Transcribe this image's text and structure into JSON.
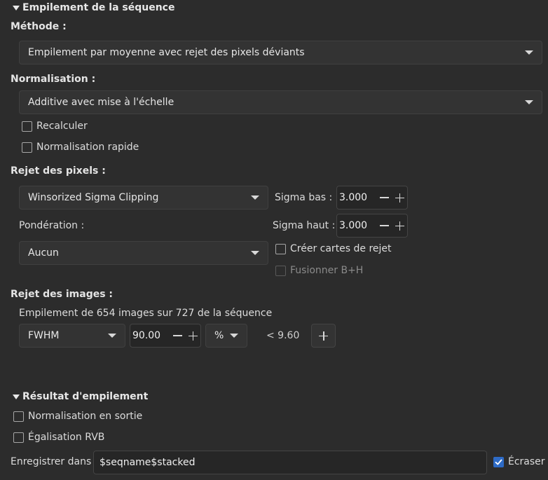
{
  "stacking": {
    "header": "Empilement de la séquence",
    "method_label": "Méthode :",
    "method_value": "Empilement par moyenne avec rejet des pixels déviants",
    "normalization_label": "Normalisation :",
    "normalization_value": "Additive avec mise à l'échelle",
    "recompute_label": "Recalculer",
    "fast_norm_label": "Normalisation rapide",
    "pixel_rejection_label": "Rejet des pixels :",
    "rejection_method_value": "Winsorized Sigma Clipping",
    "sigma_low_label": "Sigma bas :",
    "sigma_low_value": "3.000",
    "sigma_high_label": "Sigma haut :",
    "sigma_high_value": "3.000",
    "weighting_label": "Pondération :",
    "weighting_value": "Aucun",
    "rejection_maps_label": "Créer cartes de rejet",
    "merge_label": "Fusionner B+H",
    "image_rejection_label": "Rejet des images :",
    "image_rejection_info": "Empilement de 654 images sur 727 de la séquence",
    "filter_type_value": "FWHM",
    "filter_value": "90.00",
    "filter_mode_value": "%",
    "filter_threshold": "< 9.60"
  },
  "result": {
    "header": "Résultat d'empilement",
    "output_norm_label": "Normalisation en sortie",
    "rgb_eq_label": "Égalisation RVB",
    "save_in_label": "Enregistrer dans :",
    "save_in_value": "$seqname$stacked",
    "overwrite_label": "Écraser",
    "overwrite_checked": true
  },
  "colors": {
    "background": "#2c2c2c",
    "checked_accent": "#2e6bc6"
  }
}
